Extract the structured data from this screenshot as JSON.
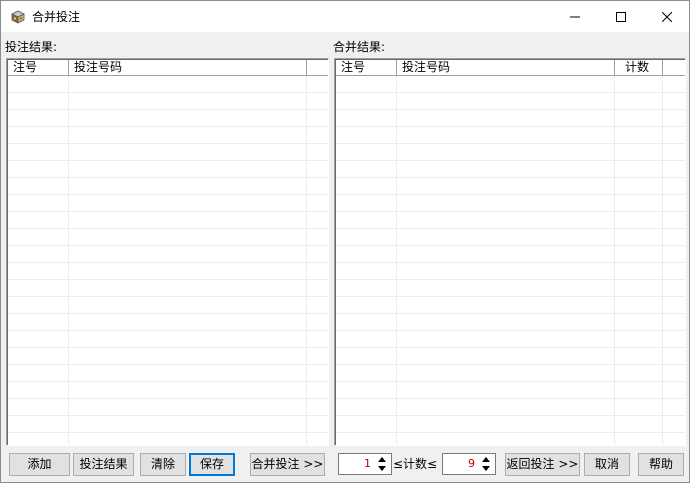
{
  "window": {
    "title": "合并投注"
  },
  "left_panel": {
    "label": "投注结果:",
    "columns": [
      "注号",
      "投注号码",
      ""
    ]
  },
  "right_panel": {
    "label": "合并结果:",
    "columns": [
      "注号",
      "投注号码",
      "计数",
      ""
    ]
  },
  "buttons": {
    "add": "添加",
    "bet_results": "投注结果",
    "clear": "清除",
    "save": "保存",
    "merge": "合并投注 >>",
    "return_bets": "返回投注 >>",
    "cancel": "取消",
    "help": "帮助"
  },
  "count_filter": {
    "min_value": "1",
    "label": "≤计数≤",
    "max_value": "9"
  },
  "icons": {
    "app": "app-icon",
    "minimize": "minimize-icon",
    "maximize": "maximize-icon",
    "close": "close-icon"
  }
}
